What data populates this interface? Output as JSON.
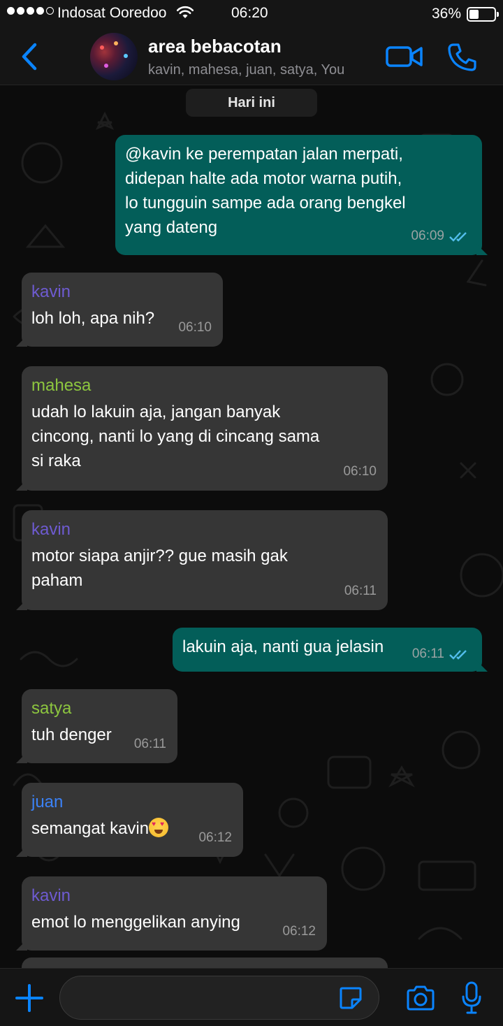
{
  "status_bar": {
    "carrier": "Indosat Ooredoo",
    "time": "06:20",
    "battery_percent": "36%",
    "signal_bars_filled": 4,
    "signal_bars_total": 5
  },
  "header": {
    "title": "area bebacotan",
    "subtitle": "kavin, mahesa, juan, satya, You",
    "icons": [
      "chevron-left-icon",
      "video-camera-icon",
      "phone-icon"
    ]
  },
  "chat": {
    "date_label": "Hari ini",
    "messages": [
      {
        "direction": "out",
        "text": "@kavin ke perempatan jalan merpati, didepan halte ada motor warna putih, lo tungguin sampe ada orang bengkel yang dateng",
        "lines": [
          "@kavin ke perempatan jalan merpati,",
          "didepan halte ada motor warna putih,",
          "lo tungguin sampe ada orang bengkel",
          "yang dateng"
        ],
        "time": "06:09",
        "status": "read"
      },
      {
        "direction": "in",
        "sender": "kavin",
        "sender_color": "#6e5bd1",
        "text": "loh loh, apa nih?",
        "time": "06:10"
      },
      {
        "direction": "in",
        "sender": "mahesa",
        "sender_color": "#8dc63f",
        "text": "udah lo lakuin aja, jangan banyak cincong, nanti lo yang di cincang sama si raka",
        "lines": [
          "udah lo lakuin aja, jangan banyak",
          "cincong, nanti lo yang di cincang sama",
          "si raka"
        ],
        "time": "06:10"
      },
      {
        "direction": "in",
        "sender": "kavin",
        "sender_color": "#6e5bd1",
        "text": "motor siapa anjir?? gue masih gak paham",
        "lines": [
          "motor siapa anjir?? gue masih gak",
          "paham"
        ],
        "time": "06:11"
      },
      {
        "direction": "out",
        "text": "lakuin aja, nanti gua jelasin",
        "time": "06:11",
        "status": "read"
      },
      {
        "direction": "in",
        "sender": "satya",
        "sender_color": "#8dc63f",
        "text": "tuh denger",
        "time": "06:11"
      },
      {
        "direction": "in",
        "sender": "juan",
        "sender_color": "#3b82f6",
        "text": "semangat kavin",
        "emoji": "heart-eyes-emoji",
        "time": "06:12"
      },
      {
        "direction": "in",
        "sender": "kavin",
        "sender_color": "#6e5bd1",
        "text": "emot lo menggelikan anying",
        "time": "06:12"
      }
    ]
  },
  "input_bar": {
    "placeholder": "",
    "icons": [
      "plus-icon",
      "sticker-icon",
      "camera-icon",
      "microphone-icon"
    ]
  },
  "colors": {
    "accent": "#0a84ff",
    "outgoing_bubble": "#035e59",
    "incoming_bubble": "#363636",
    "read_ticks": "#53bdeb",
    "background": "#0c0c0c"
  }
}
